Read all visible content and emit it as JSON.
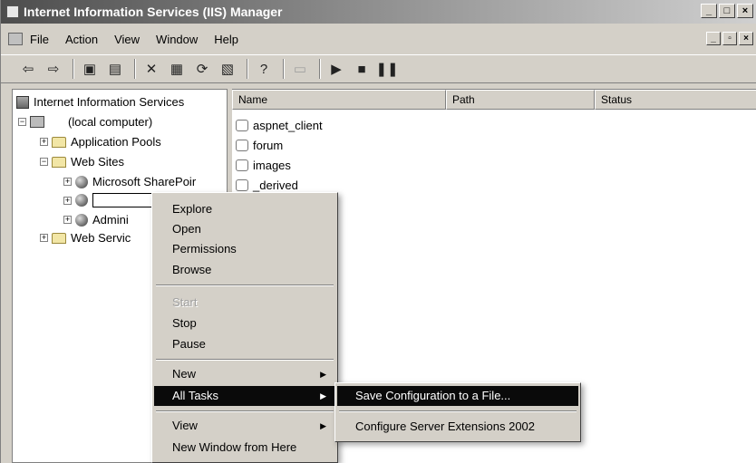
{
  "window": {
    "title": "Internet Information Services (IIS) Manager",
    "controls": [
      "_",
      "□",
      "×"
    ]
  },
  "menubar": {
    "items": [
      "File",
      "Action",
      "View",
      "Window",
      "Help"
    ],
    "child_controls": [
      "_",
      "▫",
      "×"
    ]
  },
  "toolbar": {
    "buttons": [
      {
        "icon": "back-arrow-icon",
        "glyph": "⇦"
      },
      {
        "icon": "forward-arrow-icon",
        "glyph": "⇨"
      },
      {
        "icon": "up-folder-icon",
        "glyph": "▣"
      },
      {
        "icon": "show-hide-tree-icon",
        "glyph": "▤"
      },
      {
        "icon": "delete-icon",
        "glyph": "✕"
      },
      {
        "icon": "properties-icon",
        "glyph": "▦"
      },
      {
        "icon": "refresh-icon",
        "glyph": "⟳"
      },
      {
        "icon": "export-list-icon",
        "glyph": "▧"
      },
      {
        "icon": "help-icon",
        "glyph": "?"
      },
      {
        "icon": "computer-icon",
        "glyph": "▭"
      },
      {
        "icon": "play-icon",
        "glyph": "▶"
      },
      {
        "icon": "stop-icon",
        "glyph": "■"
      },
      {
        "icon": "pause-icon",
        "glyph": "❚❚"
      }
    ]
  },
  "tree": {
    "root": "Internet Information Services",
    "computer": "(local computer)",
    "app_pools": "Application Pools",
    "web_sites": "Web Sites",
    "sharepoint": "Microsoft SharePoir",
    "admin": "Admini",
    "web_service": "Web Servic"
  },
  "list": {
    "columns": [
      "Name",
      "Path",
      "Status"
    ],
    "rows": [
      "aspnet_client",
      "forum",
      "images",
      "_derived"
    ]
  },
  "context_menu": {
    "explore": "Explore",
    "open": "Open",
    "permissions": "Permissions",
    "browse": "Browse",
    "start": "Start",
    "stop": "Stop",
    "pause": "Pause",
    "new": "New",
    "all_tasks": "All Tasks",
    "view": "View",
    "new_window": "New Window from Here",
    "arrow": "▶"
  },
  "submenu": {
    "save_config": "Save Configuration to a File...",
    "configure_ext": "Configure Server Extensions 2002"
  }
}
